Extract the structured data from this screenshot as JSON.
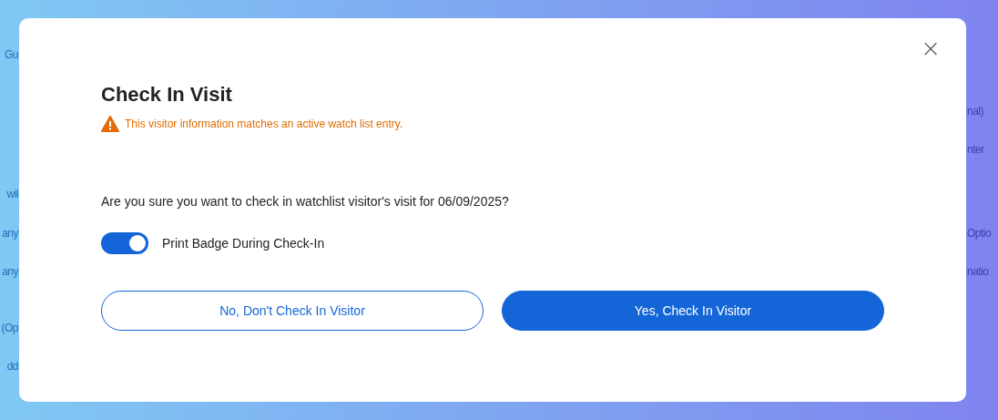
{
  "background": {
    "left_fragments": [
      "Gu",
      "wil",
      "any",
      "any",
      "(Op",
      "dd"
    ],
    "right_fragments": [
      "nal)",
      "nter",
      "Optio",
      "natio"
    ]
  },
  "dialog": {
    "close": "×",
    "title": "Check In Visit",
    "warning": "This visitor information matches an active watch list entry.",
    "question": "Are you sure you want to check in watchlist visitor's visit for 06/09/2025?",
    "toggle": {
      "label": "Print Badge During Check-In",
      "on": true
    },
    "buttons": [
      {
        "label": "No, Don't Check In Visitor",
        "kind": "secondary"
      },
      {
        "label": "Yes, Check In Visitor",
        "kind": "primary"
      }
    ]
  }
}
